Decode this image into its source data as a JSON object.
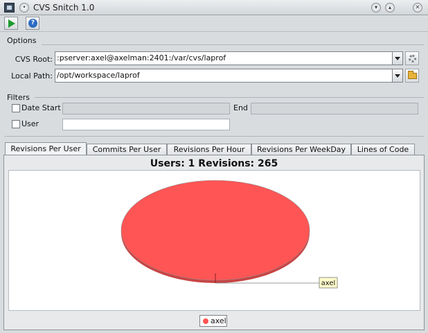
{
  "window": {
    "title": "CVS Snitch 1.0"
  },
  "toolbar": {
    "run_icon": "play-icon",
    "help_icon": "help-icon"
  },
  "options": {
    "section_title": "Options",
    "cvs_root_label": "CVS Root:",
    "cvs_root_value": ":pserver:axel@axelman:2401:/var/cvs/laprof",
    "local_path_label": "Local Path:",
    "local_path_value": "/opt/workspace/laprof"
  },
  "filters": {
    "section_title": "Filters",
    "date_start_label": "Date Start",
    "end_label": "End",
    "user_label": "User"
  },
  "tabs": [
    {
      "label": "Revisions Per User",
      "active": true
    },
    {
      "label": "Commits Per User",
      "active": false
    },
    {
      "label": "Revisions Per Hour",
      "active": false
    },
    {
      "label": "Revisions Per WeekDay",
      "active": false
    },
    {
      "label": "Lines of Code",
      "active": false
    }
  ],
  "chart_data": {
    "type": "pie",
    "title": "Users: 1 Revisions: 265",
    "slices": [
      {
        "label": "axel",
        "value": 265,
        "color": "#ff5555"
      }
    ],
    "legend": [
      "axel"
    ],
    "legend_placement": "bottom"
  },
  "colors": {
    "slice": "#ff5555",
    "slice_edge": "#8a8a8a"
  }
}
